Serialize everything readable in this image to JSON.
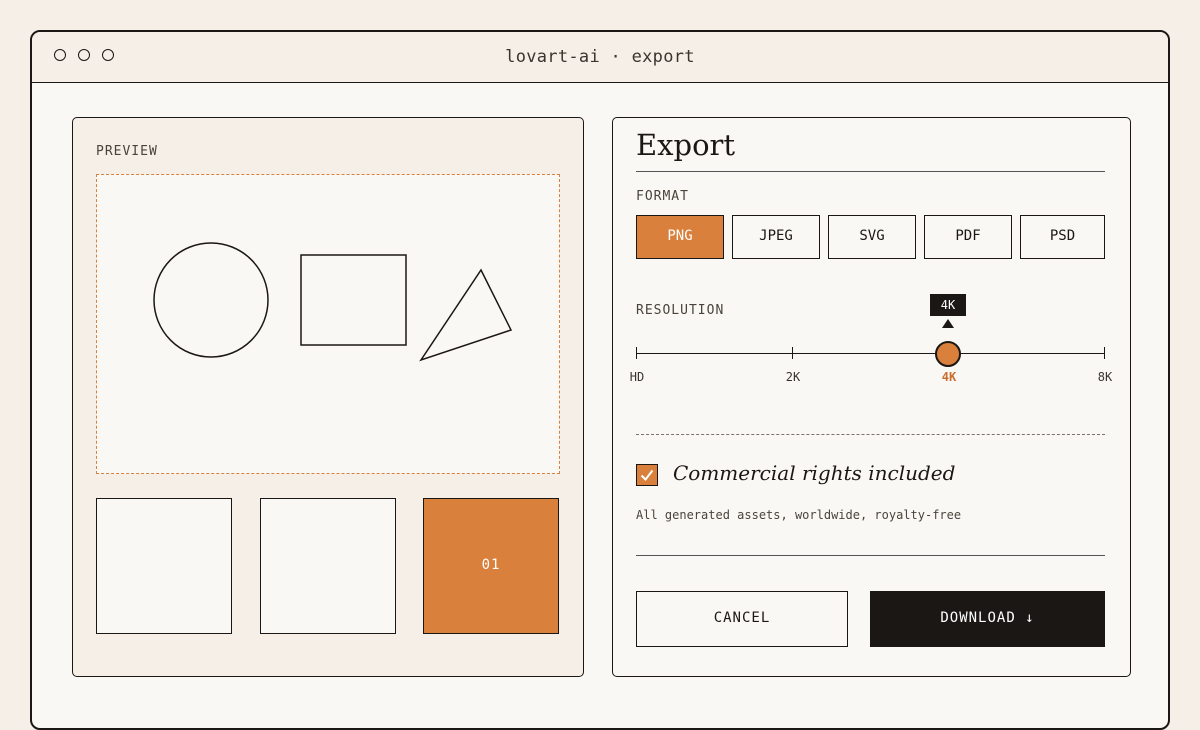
{
  "window": {
    "title": "lovart-ai · export"
  },
  "preview": {
    "label": "PREVIEW",
    "thumbnails": [
      {
        "label": "",
        "active": false
      },
      {
        "label": "",
        "active": false
      },
      {
        "label": "01",
        "active": true
      }
    ]
  },
  "export": {
    "title": "Export",
    "format_label": "FORMAT",
    "formats": [
      "PNG",
      "JPEG",
      "SVG",
      "PDF",
      "PSD"
    ],
    "selected_format": "PNG",
    "resolution_label": "RESOLUTION",
    "resolution_options": [
      "HD",
      "2K",
      "4K",
      "8K"
    ],
    "resolution_value": "4K",
    "rights_checked": true,
    "rights_label": "Commercial rights included",
    "rights_sub": "All generated assets, worldwide, royalty-free",
    "cancel_label": "CANCEL",
    "download_label": "DOWNLOAD ↓"
  },
  "colors": {
    "accent": "#d9803d",
    "ink": "#1a1714",
    "paper": "#faf8f4",
    "background": "#f5efe7"
  }
}
